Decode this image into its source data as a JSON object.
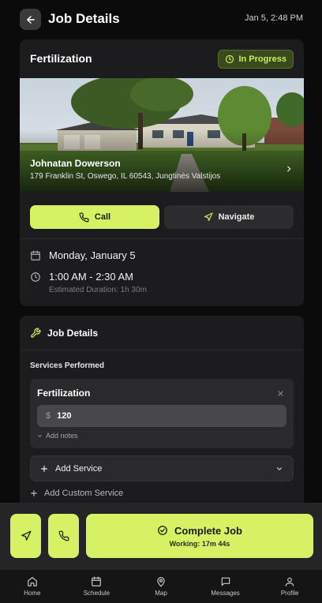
{
  "header": {
    "title": "Job Details",
    "timestamp": "Jan 5, 2:48 PM",
    "back_icon": "arrow-left-icon"
  },
  "job": {
    "title": "Fertilization",
    "status": "In Progress",
    "status_color": "#c9ec5b",
    "customer_name": "Johnatan Dowerson",
    "address": "179 Franklin St, Oswego, IL 60543, Jungtinės Valstijos",
    "call_label": "Call",
    "navigate_label": "Navigate",
    "date": "Monday, January 5",
    "time_range": "1:00 AM - 2:30 AM",
    "estimated_duration": "Estimated Duration: 1h 30m"
  },
  "details": {
    "header": "Job Details",
    "services_label": "Services Performed",
    "services": [
      {
        "name": "Fertilization",
        "currency_symbol": "$",
        "price": "120",
        "notes_label": "Add notes"
      }
    ],
    "add_service_label": "Add Service",
    "add_custom_label": "Add Custom Service"
  },
  "actions": {
    "complete_label": "Complete Job",
    "working_label": "Working: 17m 44s",
    "accent": "#d6f264"
  },
  "tabs": [
    {
      "label": "Home",
      "icon": "home-icon"
    },
    {
      "label": "Schedule",
      "icon": "calendar-icon"
    },
    {
      "label": "Map",
      "icon": "map-pin-icon"
    },
    {
      "label": "Messages",
      "icon": "message-icon"
    },
    {
      "label": "Profile",
      "icon": "user-icon"
    }
  ]
}
